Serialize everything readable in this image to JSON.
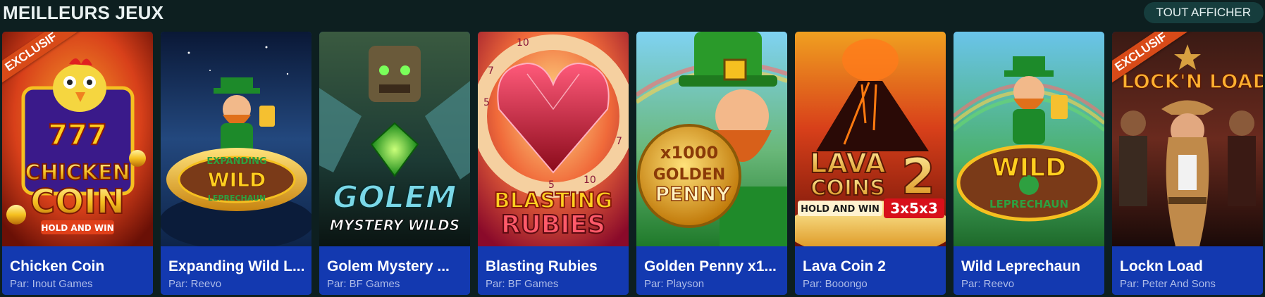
{
  "header": {
    "title": "MEILLEURS JEUX",
    "view_all_label": "TOUT AFFICHER"
  },
  "games": [
    {
      "name": "Chicken Coin",
      "provider": "Par: Inout Games",
      "badge": "EXCLUSIF",
      "art": {
        "line1": "777",
        "line2": "CHICKEN",
        "line3": "COIN",
        "line4": "HOLD AND WIN"
      },
      "colors": {
        "bg1": "#e8581a",
        "bg2": "#7a1208"
      }
    },
    {
      "name": "Expanding Wild L...",
      "provider": "Par: Reevo",
      "art": {
        "line1": "EXPANDING",
        "line2": "WILD",
        "line3": "LEPRECHAUN"
      },
      "colors": {
        "bg1": "#1c3b6e",
        "bg2": "#071430"
      }
    },
    {
      "name": "Golem Mystery ...",
      "provider": "Par: BF Games",
      "art": {
        "line1": "GOLEM",
        "line2": "MYSTERY WILDS"
      },
      "colors": {
        "bg1": "#2d5a4a",
        "bg2": "#0c1e1c"
      }
    },
    {
      "name": "Blasting Rubies",
      "provider": "Par: BF Games",
      "art": {
        "line1": "BLASTING",
        "line2": "RUBIES",
        "ticks": [
          "10",
          "7",
          "5",
          "7",
          "5",
          "10"
        ]
      },
      "colors": {
        "bg1": "#f2a33a",
        "bg2": "#b81a3c"
      }
    },
    {
      "name": "Golden Penny x1...",
      "provider": "Par: Playson",
      "art": {
        "line1": "x1000",
        "line2": "GOLDEN",
        "line3": "PENNY"
      },
      "colors": {
        "bg1": "#8fd7f0",
        "bg2": "#2f9a3c"
      }
    },
    {
      "name": "Lava Coin 2",
      "provider": "Par: Booongo",
      "art": {
        "line1": "LAVA",
        "line2": "COINS",
        "line3": "2",
        "line4": "HOLD AND WIN",
        "line5": "3x5x3"
      },
      "colors": {
        "bg1": "#f0a020",
        "bg2": "#8a1a08"
      }
    },
    {
      "name": "Wild Leprechaun",
      "provider": "Par: Reevo",
      "art": {
        "line1": "WILD",
        "line2": "LEPRECHAUN"
      },
      "colors": {
        "bg1": "#6fc3e8",
        "bg2": "#2f8a3a"
      }
    },
    {
      "name": "Lockn Load",
      "provider": "Par: Peter And Sons",
      "badge": "EXCLUSIF",
      "art": {
        "line1": "LOCK'N LOAD"
      },
      "colors": {
        "bg1": "#5a2a1e",
        "bg2": "#1a0c0a"
      }
    }
  ]
}
